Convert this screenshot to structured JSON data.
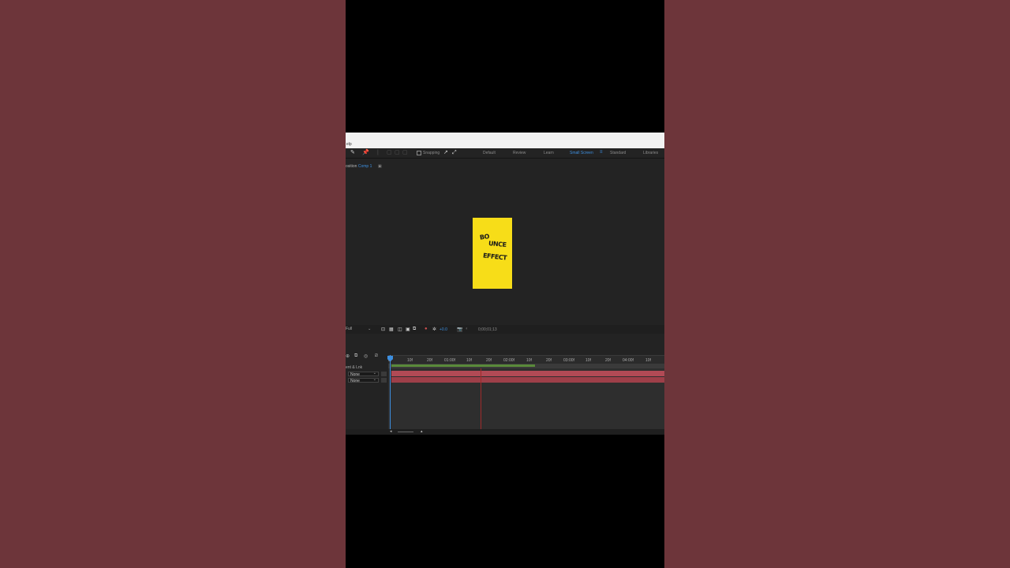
{
  "menubar": {
    "help": "elp"
  },
  "toolbar": {
    "snapping_label": "Snapping",
    "workspaces": [
      {
        "label": "Default",
        "active": false
      },
      {
        "label": "Review",
        "active": false
      },
      {
        "label": "Learn",
        "active": false
      },
      {
        "label": "Small Screen",
        "active": true
      },
      {
        "label": "Standard",
        "active": false
      },
      {
        "label": "Libraries",
        "active": false
      }
    ],
    "workspace_menu_icon": "hamburger-icon"
  },
  "composition": {
    "tab_prefix": "osition",
    "comp_name": "Comp 1",
    "lock_icon": "lock-icon"
  },
  "card": {
    "background": "#f7dd18",
    "line1a": "BO",
    "line1b": "UNCE",
    "line2": "EFFECT"
  },
  "viewer_bar": {
    "resolution": "Full",
    "exposure": "+0.0",
    "timecode": "0;00;01;13"
  },
  "timeline": {
    "ticks": [
      "0f",
      "10f",
      "20f",
      "01:00f",
      "10f",
      "20f",
      "02:00f",
      "10f",
      "20f",
      "03:00f",
      "10f",
      "20f",
      "04:00f",
      "10f"
    ],
    "layer_header": "ent & Lnk",
    "parent_options": [
      "None",
      "None"
    ],
    "playhead_color": "#3d8fe0",
    "track_color": "#b14a55"
  }
}
